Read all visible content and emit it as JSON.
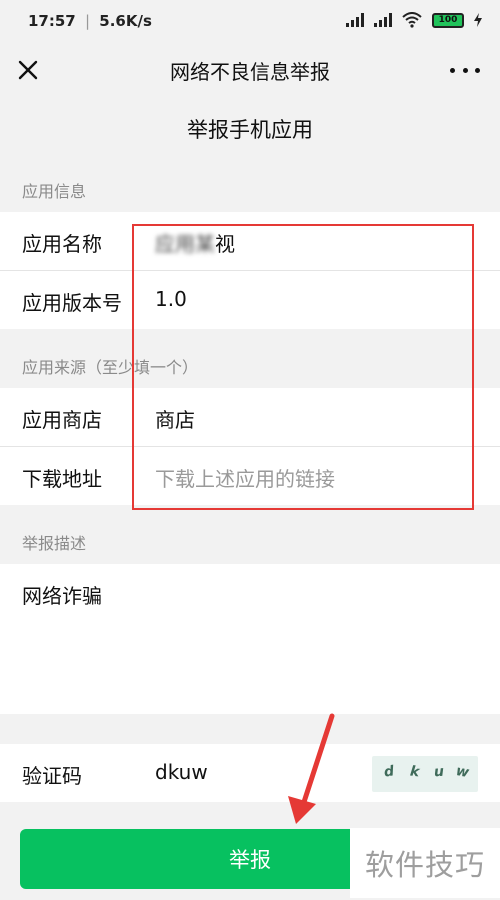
{
  "status": {
    "time": "17:57",
    "speed": "5.6K/s",
    "battery": "100"
  },
  "nav": {
    "title": "网络不良信息举报"
  },
  "page_title": "举报手机应用",
  "sections": {
    "app_info": "应用信息",
    "source": "应用来源（至少填一个）",
    "description": "举报描述"
  },
  "fields": {
    "app_name_label": "应用名称",
    "app_name_value": "视",
    "version_label": "应用版本号",
    "version_value": "1.0",
    "store_label": "应用商店",
    "store_value": "商店",
    "download_label": "下载地址",
    "download_placeholder": "下载上述应用的链接",
    "description_value": "网络诈骗",
    "captcha_label": "验证码",
    "captcha_value": "dkuw"
  },
  "submit_label": "举报",
  "watermark": "软件技巧",
  "colors": {
    "accent": "#07c160",
    "highlight": "#e53935"
  }
}
